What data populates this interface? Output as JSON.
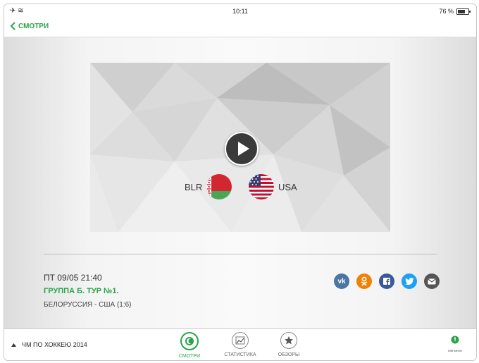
{
  "status_bar": {
    "time": "10:11",
    "battery": "76 %"
  },
  "nav": {
    "back_label": "СМОТРИ"
  },
  "video": {
    "team_home": {
      "code": "BLR",
      "flag": "belarus-flag"
    },
    "team_away": {
      "code": "USA",
      "flag": "usa-flag"
    }
  },
  "match": {
    "date": "ПТ 09/05 21:40",
    "group": "ГРУППА Б. ТУР №1.",
    "score": "БЕЛОРУССИЯ - США (1:6)"
  },
  "social": [
    "vk-icon",
    "odnoklassniki-icon",
    "facebook-icon",
    "twitter-icon",
    "email-icon"
  ],
  "tabbar": {
    "league": "ЧМ ПО ХОККЕЮ 2014",
    "tabs": [
      {
        "label": "СМОТРИ",
        "active": true
      },
      {
        "label": "СТАТИСТИКА",
        "active": false
      },
      {
        "label": "ОБЗОРЫ",
        "active": false
      }
    ],
    "partner": "МЕГАФОН"
  },
  "colors": {
    "accent": "#2aa44a",
    "vk": "#4c75a3",
    "ok": "#ee8208",
    "facebook": "#3b5998",
    "twitter": "#1da1f2",
    "email": "#555555"
  }
}
